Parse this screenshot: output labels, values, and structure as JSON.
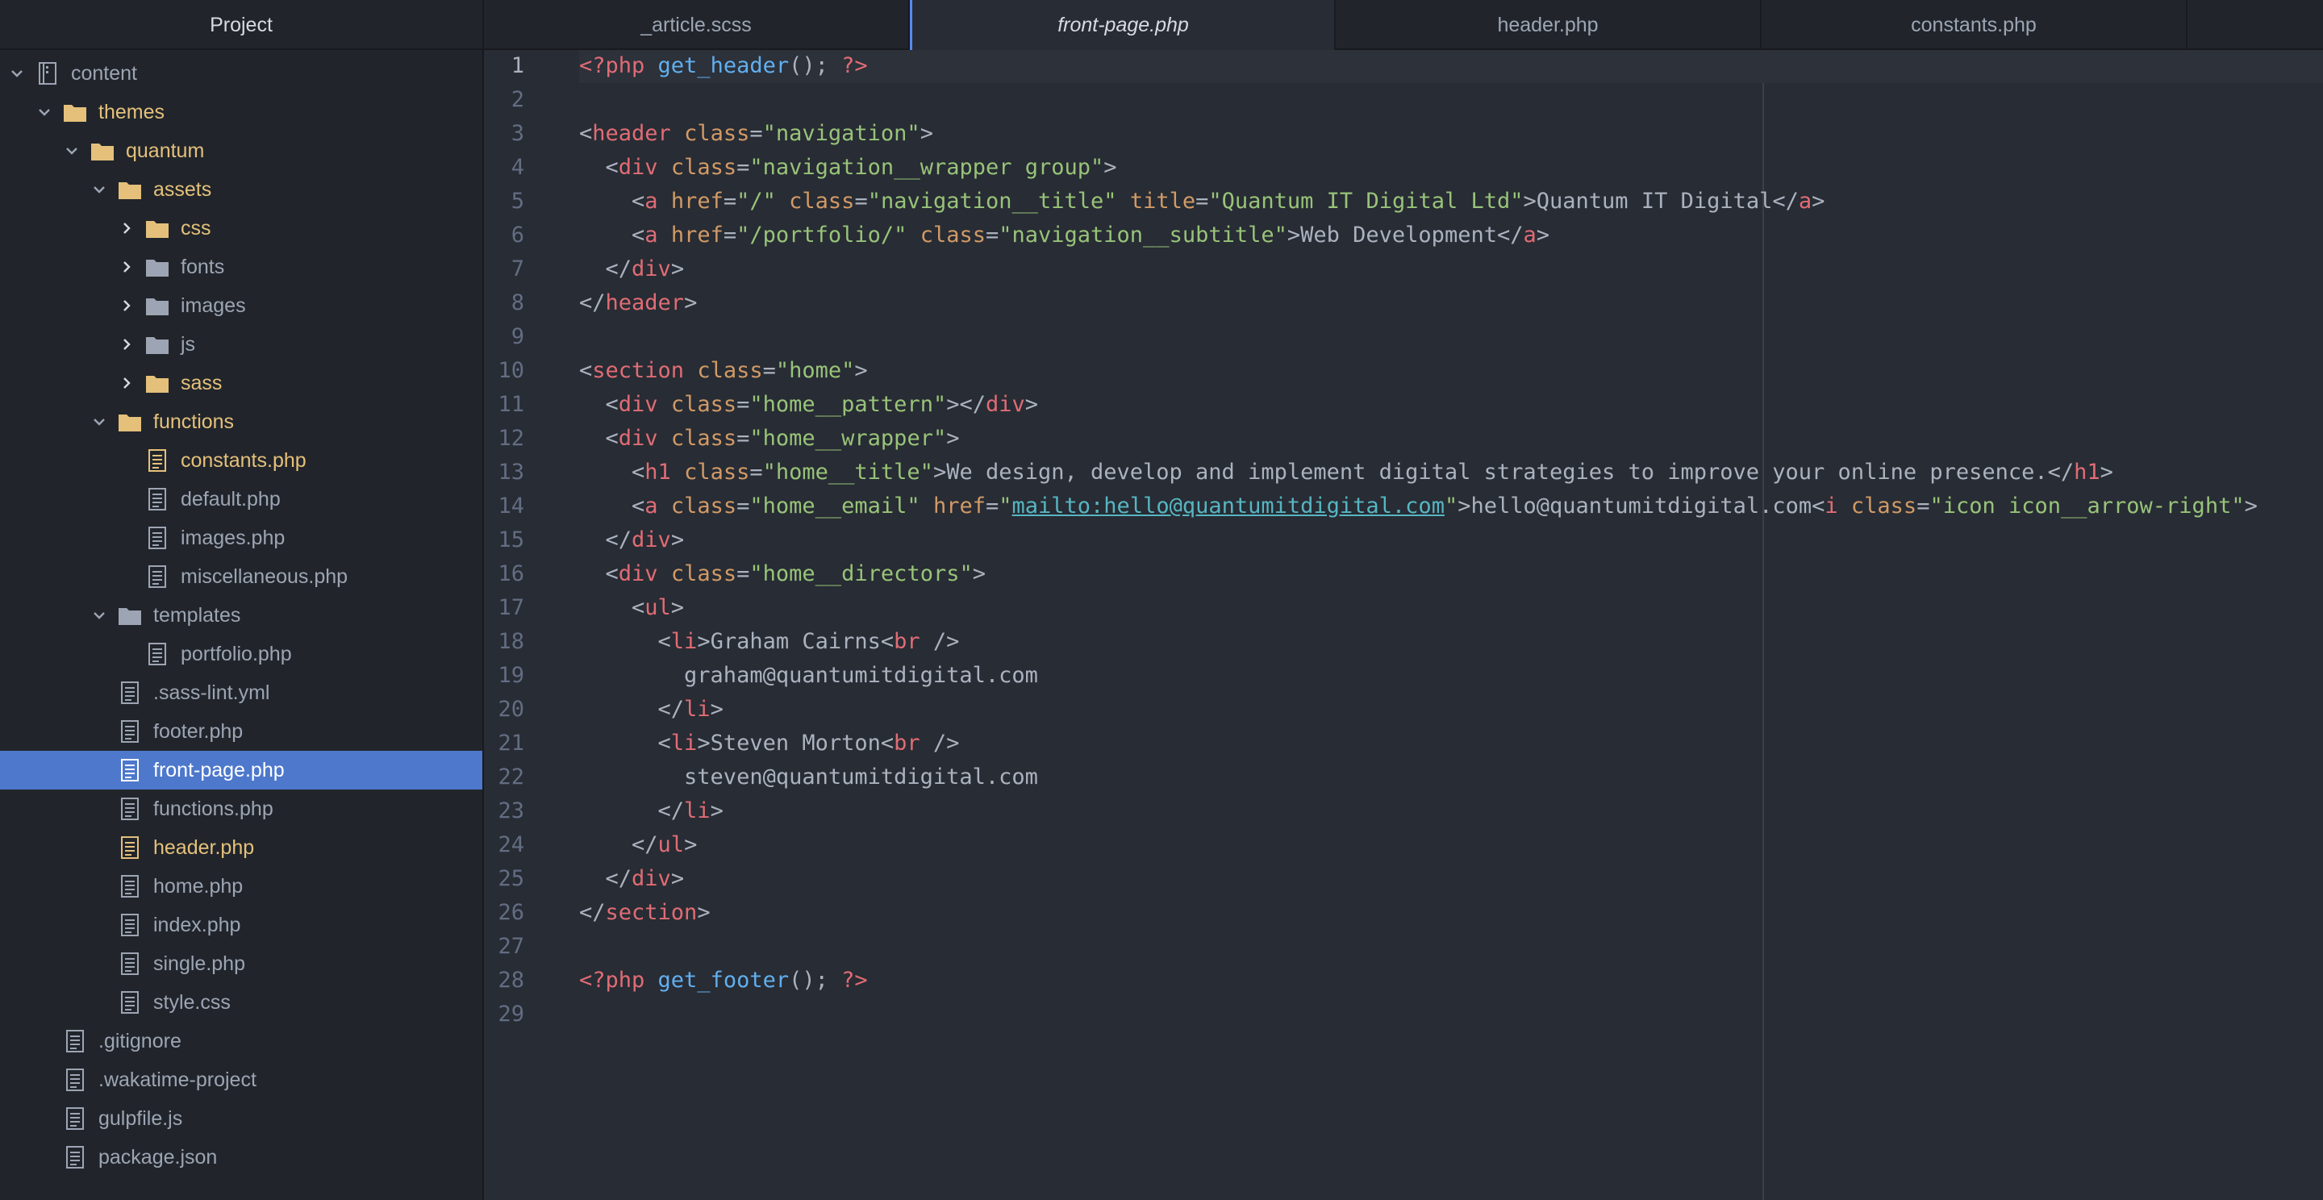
{
  "sidebar": {
    "title": "Project",
    "tree": [
      {
        "label": "content",
        "type": "repo",
        "depth": 0,
        "expanded": true
      },
      {
        "label": "themes",
        "type": "folder",
        "depth": 1,
        "expanded": true,
        "modified": true
      },
      {
        "label": "quantum",
        "type": "folder",
        "depth": 2,
        "expanded": true,
        "modified": true
      },
      {
        "label": "assets",
        "type": "folder",
        "depth": 3,
        "expanded": true,
        "modified": true
      },
      {
        "label": "css",
        "type": "folder",
        "depth": 4,
        "expanded": false,
        "modified": true
      },
      {
        "label": "fonts",
        "type": "folder",
        "depth": 4,
        "expanded": false
      },
      {
        "label": "images",
        "type": "folder",
        "depth": 4,
        "expanded": false
      },
      {
        "label": "js",
        "type": "folder",
        "depth": 4,
        "expanded": false
      },
      {
        "label": "sass",
        "type": "folder",
        "depth": 4,
        "expanded": false,
        "modified": true
      },
      {
        "label": "functions",
        "type": "folder",
        "depth": 3,
        "expanded": true,
        "modified": true
      },
      {
        "label": "constants.php",
        "type": "file",
        "depth": 4,
        "modified": true
      },
      {
        "label": "default.php",
        "type": "file",
        "depth": 4
      },
      {
        "label": "images.php",
        "type": "file",
        "depth": 4
      },
      {
        "label": "miscellaneous.php",
        "type": "file",
        "depth": 4
      },
      {
        "label": "templates",
        "type": "folder",
        "depth": 3,
        "expanded": true
      },
      {
        "label": "portfolio.php",
        "type": "file",
        "depth": 4
      },
      {
        "label": ".sass-lint.yml",
        "type": "file",
        "depth": 3
      },
      {
        "label": "footer.php",
        "type": "file",
        "depth": 3
      },
      {
        "label": "front-page.php",
        "type": "file",
        "depth": 3,
        "selected": true,
        "modified": true
      },
      {
        "label": "functions.php",
        "type": "file",
        "depth": 3
      },
      {
        "label": "header.php",
        "type": "file",
        "depth": 3,
        "modified": true
      },
      {
        "label": "home.php",
        "type": "file",
        "depth": 3
      },
      {
        "label": "index.php",
        "type": "file",
        "depth": 3
      },
      {
        "label": "single.php",
        "type": "file",
        "depth": 3
      },
      {
        "label": "style.css",
        "type": "file",
        "depth": 3
      },
      {
        "label": ".gitignore",
        "type": "file",
        "depth": 1
      },
      {
        "label": ".wakatime-project",
        "type": "file",
        "depth": 1
      },
      {
        "label": "gulpfile.js",
        "type": "file",
        "depth": 1
      },
      {
        "label": "package.json",
        "type": "file",
        "depth": 1
      }
    ]
  },
  "tabs": [
    {
      "label": "_article.scss",
      "active": false
    },
    {
      "label": "front-page.php",
      "active": true
    },
    {
      "label": "header.php",
      "active": false
    },
    {
      "label": "constants.php",
      "active": false
    }
  ],
  "editor": {
    "current_line": 1,
    "lines": [
      [
        [
          "php",
          "<?php"
        ],
        [
          "pl",
          " "
        ],
        [
          "fn",
          "get_header"
        ],
        [
          "pl",
          "(); "
        ],
        [
          "php",
          "?>"
        ]
      ],
      [],
      [
        [
          "pl",
          "<"
        ],
        [
          "tag",
          "header"
        ],
        [
          "pl",
          " "
        ],
        [
          "attr",
          "class"
        ],
        [
          "pl",
          "="
        ],
        [
          "str",
          "\"navigation\""
        ],
        [
          "pl",
          ">"
        ]
      ],
      [
        [
          "pl",
          "  <"
        ],
        [
          "tag",
          "div"
        ],
        [
          "pl",
          " "
        ],
        [
          "attr",
          "class"
        ],
        [
          "pl",
          "="
        ],
        [
          "str",
          "\"navigation__wrapper group\""
        ],
        [
          "pl",
          ">"
        ]
      ],
      [
        [
          "pl",
          "    <"
        ],
        [
          "tag",
          "a"
        ],
        [
          "pl",
          " "
        ],
        [
          "attr",
          "href"
        ],
        [
          "pl",
          "="
        ],
        [
          "str",
          "\"/\""
        ],
        [
          "pl",
          " "
        ],
        [
          "attr",
          "class"
        ],
        [
          "pl",
          "="
        ],
        [
          "str",
          "\"navigation__title\""
        ],
        [
          "pl",
          " "
        ],
        [
          "attr",
          "title"
        ],
        [
          "pl",
          "="
        ],
        [
          "str",
          "\"Quantum IT Digital Ltd\""
        ],
        [
          "pl",
          ">Quantum IT Digital</"
        ],
        [
          "tag",
          "a"
        ],
        [
          "pl",
          ">"
        ]
      ],
      [
        [
          "pl",
          "    <"
        ],
        [
          "tag",
          "a"
        ],
        [
          "pl",
          " "
        ],
        [
          "attr",
          "href"
        ],
        [
          "pl",
          "="
        ],
        [
          "str",
          "\"/portfolio/\""
        ],
        [
          "pl",
          " "
        ],
        [
          "attr",
          "class"
        ],
        [
          "pl",
          "="
        ],
        [
          "str",
          "\"navigation__subtitle\""
        ],
        [
          "pl",
          ">Web Development</"
        ],
        [
          "tag",
          "a"
        ],
        [
          "pl",
          ">"
        ]
      ],
      [
        [
          "pl",
          "  </"
        ],
        [
          "tag",
          "div"
        ],
        [
          "pl",
          ">"
        ]
      ],
      [
        [
          "pl",
          "</"
        ],
        [
          "tag",
          "header"
        ],
        [
          "pl",
          ">"
        ]
      ],
      [],
      [
        [
          "pl",
          "<"
        ],
        [
          "tag",
          "section"
        ],
        [
          "pl",
          " "
        ],
        [
          "attr",
          "class"
        ],
        [
          "pl",
          "="
        ],
        [
          "str",
          "\"home\""
        ],
        [
          "pl",
          ">"
        ]
      ],
      [
        [
          "pl",
          "  <"
        ],
        [
          "tag",
          "div"
        ],
        [
          "pl",
          " "
        ],
        [
          "attr",
          "class"
        ],
        [
          "pl",
          "="
        ],
        [
          "str",
          "\"home__pattern\""
        ],
        [
          "pl",
          "></"
        ],
        [
          "tag",
          "div"
        ],
        [
          "pl",
          ">"
        ]
      ],
      [
        [
          "pl",
          "  <"
        ],
        [
          "tag",
          "div"
        ],
        [
          "pl",
          " "
        ],
        [
          "attr",
          "class"
        ],
        [
          "pl",
          "="
        ],
        [
          "str",
          "\"home__wrapper\""
        ],
        [
          "pl",
          ">"
        ]
      ],
      [
        [
          "pl",
          "    <"
        ],
        [
          "tag",
          "h1"
        ],
        [
          "pl",
          " "
        ],
        [
          "attr",
          "class"
        ],
        [
          "pl",
          "="
        ],
        [
          "str",
          "\"home__title\""
        ],
        [
          "pl",
          ">We design, develop and implement digital strategies to improve your online presence.</"
        ],
        [
          "tag",
          "h1"
        ],
        [
          "pl",
          ">"
        ]
      ],
      [
        [
          "pl",
          "    <"
        ],
        [
          "tag",
          "a"
        ],
        [
          "pl",
          " "
        ],
        [
          "attr",
          "class"
        ],
        [
          "pl",
          "="
        ],
        [
          "str",
          "\"home__email\""
        ],
        [
          "pl",
          " "
        ],
        [
          "attr",
          "href"
        ],
        [
          "pl",
          "="
        ],
        [
          "str",
          "\""
        ],
        [
          "link",
          "mailto:hello@quantumitdigital.com"
        ],
        [
          "str",
          "\""
        ],
        [
          "pl",
          ">hello@quantumitdigital.com<"
        ],
        [
          "tag",
          "i"
        ],
        [
          "pl",
          " "
        ],
        [
          "attr",
          "class"
        ],
        [
          "pl",
          "="
        ],
        [
          "str",
          "\"icon icon__arrow-right\""
        ],
        [
          "pl",
          ">"
        ]
      ],
      [
        [
          "pl",
          "  </"
        ],
        [
          "tag",
          "div"
        ],
        [
          "pl",
          ">"
        ]
      ],
      [
        [
          "pl",
          "  <"
        ],
        [
          "tag",
          "div"
        ],
        [
          "pl",
          " "
        ],
        [
          "attr",
          "class"
        ],
        [
          "pl",
          "="
        ],
        [
          "str",
          "\"home__directors\""
        ],
        [
          "pl",
          ">"
        ]
      ],
      [
        [
          "pl",
          "    <"
        ],
        [
          "tag",
          "ul"
        ],
        [
          "pl",
          ">"
        ]
      ],
      [
        [
          "pl",
          "      <"
        ],
        [
          "tag",
          "li"
        ],
        [
          "pl",
          ">Graham Cairns<"
        ],
        [
          "tag",
          "br"
        ],
        [
          "pl",
          " />"
        ]
      ],
      [
        [
          "pl",
          "        graham@quantumitdigital.com"
        ]
      ],
      [
        [
          "pl",
          "      </"
        ],
        [
          "tag",
          "li"
        ],
        [
          "pl",
          ">"
        ]
      ],
      [
        [
          "pl",
          "      <"
        ],
        [
          "tag",
          "li"
        ],
        [
          "pl",
          ">Steven Morton<"
        ],
        [
          "tag",
          "br"
        ],
        [
          "pl",
          " />"
        ]
      ],
      [
        [
          "pl",
          "        steven@quantumitdigital.com"
        ]
      ],
      [
        [
          "pl",
          "      </"
        ],
        [
          "tag",
          "li"
        ],
        [
          "pl",
          ">"
        ]
      ],
      [
        [
          "pl",
          "    </"
        ],
        [
          "tag",
          "ul"
        ],
        [
          "pl",
          ">"
        ]
      ],
      [
        [
          "pl",
          "  </"
        ],
        [
          "tag",
          "div"
        ],
        [
          "pl",
          ">"
        ]
      ],
      [
        [
          "pl",
          "</"
        ],
        [
          "tag",
          "section"
        ],
        [
          "pl",
          ">"
        ]
      ],
      [],
      [
        [
          "php",
          "<?php"
        ],
        [
          "pl",
          " "
        ],
        [
          "fn",
          "get_footer"
        ],
        [
          "pl",
          "(); "
        ],
        [
          "php",
          "?>"
        ]
      ],
      []
    ]
  },
  "colors": {
    "accent": "#4d78cc",
    "modified": "#e5c07b",
    "folder_modified": "#e5c07b",
    "folder": "#9da5b4"
  }
}
